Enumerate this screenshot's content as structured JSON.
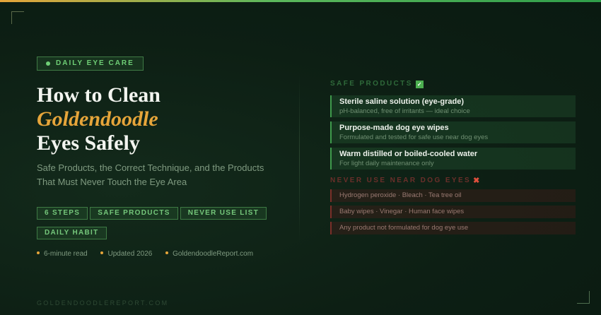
{
  "badge": {
    "label": "DAILY EYE CARE"
  },
  "title": {
    "line1": "How to Clean",
    "accent": "Goldendoodle",
    "line3": "Eyes Safely"
  },
  "subtitle": "Safe Products, the Correct Technique, and the Products That Must Never Touch the Eye Area",
  "tags": [
    "6 STEPS",
    "SAFE PRODUCTS",
    "NEVER USE LIST",
    "DAILY HABIT"
  ],
  "meta": [
    "6-minute read",
    "Updated 2026",
    "GoldendoodleReport.com"
  ],
  "footer": "GOLDENDOODLEREPORT.COM",
  "safe": {
    "heading": "SAFE PRODUCTS",
    "icon": "check-icon",
    "items": [
      {
        "name": "Sterile saline solution (eye-grade)",
        "desc": "pH-balanced, free of irritants — ideal choice"
      },
      {
        "name": "Purpose-made dog eye wipes",
        "desc": "Formulated and tested for safe use near dog eyes"
      },
      {
        "name": "Warm distilled or boiled-cooled water",
        "desc": "For light daily maintenance only"
      }
    ]
  },
  "never": {
    "heading": "NEVER USE NEAR DOG EYES",
    "icon": "x-icon",
    "items": [
      "Hydrogen peroxide · Bleach · Tea tree oil",
      "Baby wipes · Vinegar · Human face wipes",
      "Any product not formulated for dog eye use"
    ]
  },
  "colors": {
    "accent": "#e6a53a",
    "green": "#6fcf76",
    "danger": "#e0503d"
  }
}
